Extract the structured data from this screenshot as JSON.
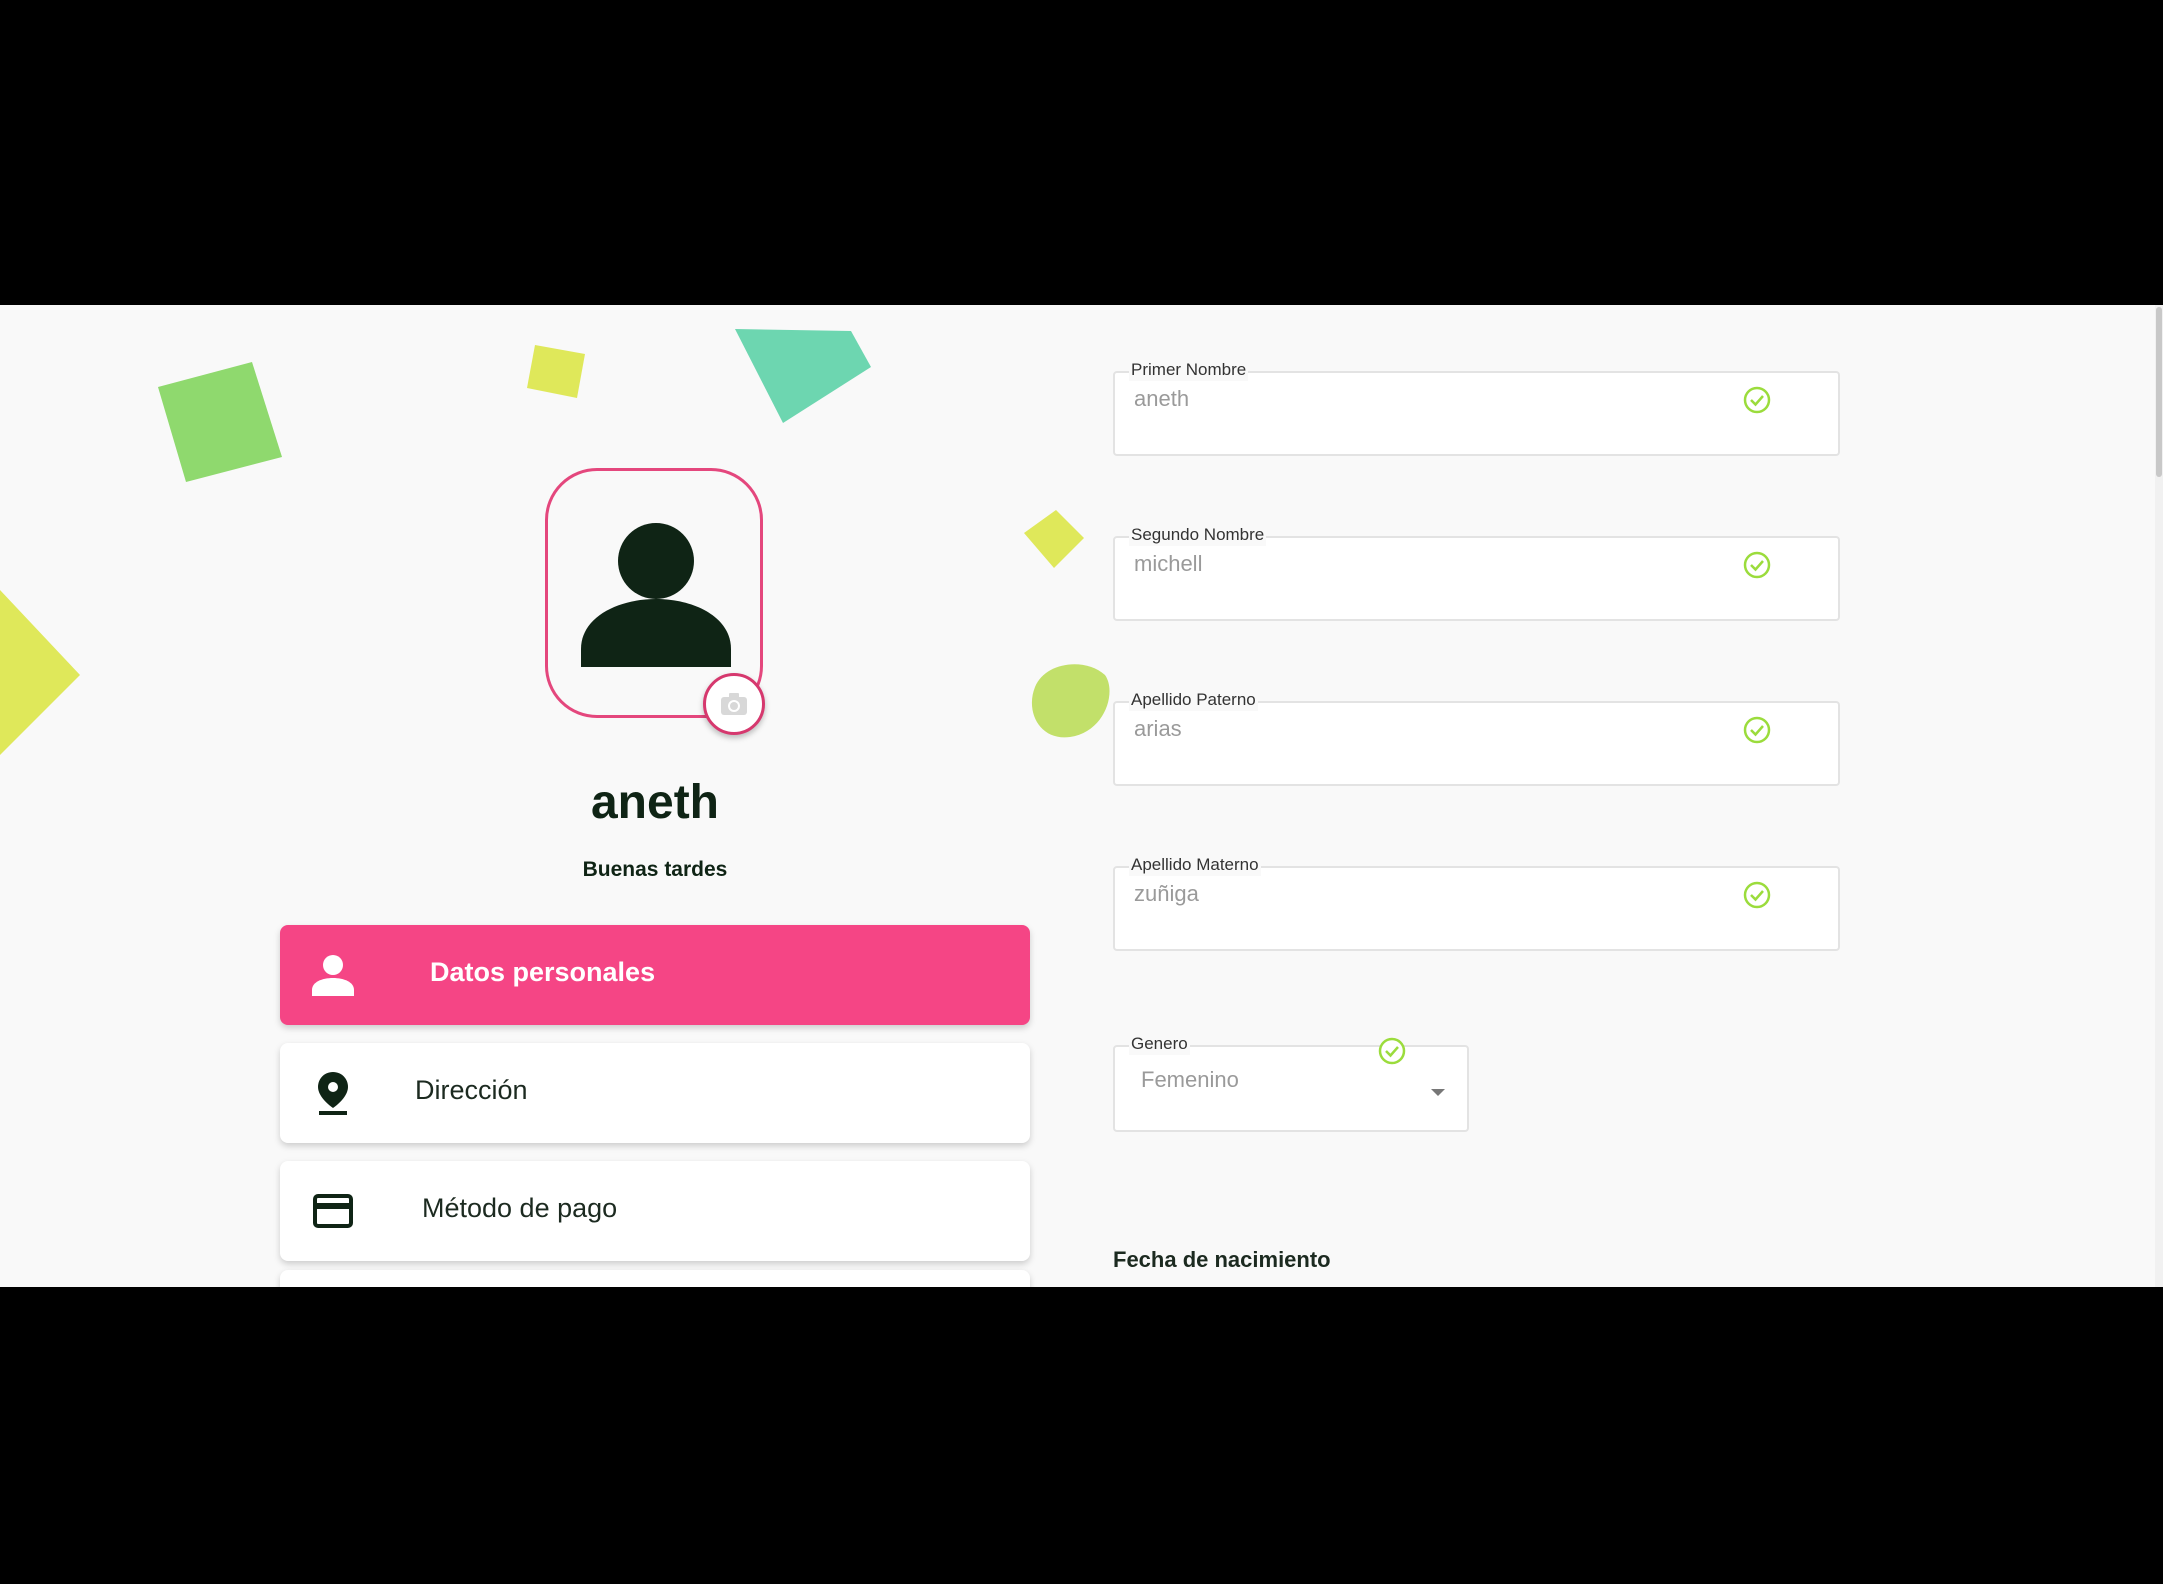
{
  "profile": {
    "name": "aneth",
    "greeting": "Buenas tardes"
  },
  "menu": {
    "items": [
      {
        "label": "Datos personales",
        "icon": "person-icon",
        "active": true
      },
      {
        "label": "Dirección",
        "icon": "location-pin-icon",
        "active": false
      },
      {
        "label": "Método de pago",
        "icon": "credit-card-icon",
        "active": false
      }
    ]
  },
  "form": {
    "primer_nombre": {
      "label": "Primer Nombre",
      "value": "aneth"
    },
    "segundo_nombre": {
      "label": "Segundo Nombre",
      "value": "michell"
    },
    "apellido_paterno": {
      "label": "Apellido Paterno",
      "value": "arias"
    },
    "apellido_materno": {
      "label": "Apellido Materno",
      "value": "zuñiga"
    },
    "genero": {
      "label": "Genero",
      "value": "Femenino"
    },
    "fecha_nacimiento_title": "Fecha de nacimiento"
  },
  "colors": {
    "accent": "#f54585",
    "text_dark": "#0f2415",
    "check_green": "#9bdc3c",
    "shape_green": "#8fd96e",
    "shape_yellow": "#dfe85a",
    "shape_teal": "#6dd6b0",
    "background": "#f9f9f9"
  }
}
